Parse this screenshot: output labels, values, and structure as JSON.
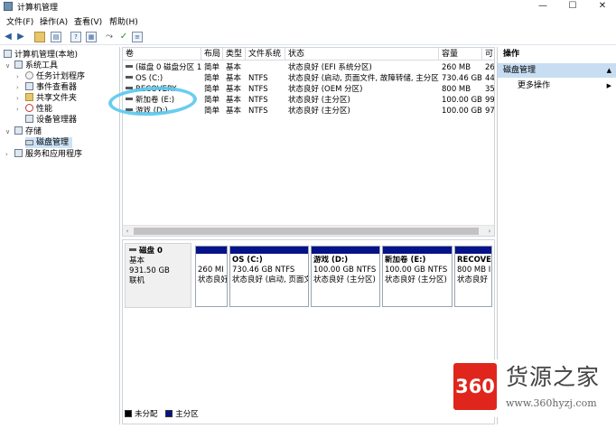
{
  "window": {
    "title": "计算机管理",
    "controls": {
      "minimize": "—",
      "maximize": "☐",
      "close": "✕"
    }
  },
  "menu": [
    "文件(F)",
    "操作(A)",
    "查看(V)",
    "帮助(H)"
  ],
  "toolbar_icons": [
    "back-arrow-icon",
    "forward-arrow-icon",
    "up-folder-icon",
    "show-hide-tree-icon",
    "help-icon",
    "properties-icon",
    "connect-icon",
    "checkmark-icon",
    "list-view-icon"
  ],
  "tree": {
    "root": "计算机管理(本地)",
    "system_tools": "系统工具",
    "task_scheduler": "任务计划程序",
    "event_viewer": "事件查看器",
    "shared_folders": "共享文件夹",
    "performance": "性能",
    "device_manager": "设备管理器",
    "storage": "存储",
    "disk_management": "磁盘管理",
    "services": "服务和应用程序"
  },
  "volume_table": {
    "headers": [
      "卷",
      "布局",
      "类型",
      "文件系统",
      "状态",
      "容量",
      "可"
    ],
    "rows": [
      {
        "name": "(磁盘 0 磁盘分区 1)",
        "layout": "简单",
        "type": "基本",
        "fs": "",
        "status": "状态良好 (EFI 系统分区)",
        "capacity": "260 MB",
        "free": "26"
      },
      {
        "name": "OS (C:)",
        "layout": "简单",
        "type": "基本",
        "fs": "NTFS",
        "status": "状态良好 (启动, 页面文件, 故障转储, 主分区)",
        "capacity": "730.46 GB",
        "free": "44"
      },
      {
        "name": "RECOVERY",
        "layout": "简单",
        "type": "基本",
        "fs": "NTFS",
        "status": "状态良好 (OEM 分区)",
        "capacity": "800 MB",
        "free": "35"
      },
      {
        "name": "新加卷 (E:)",
        "layout": "简单",
        "type": "基本",
        "fs": "NTFS",
        "status": "状态良好 (主分区)",
        "capacity": "100.00 GB",
        "free": "99"
      },
      {
        "name": "游戏 (D:)",
        "layout": "简单",
        "type": "基本",
        "fs": "NTFS",
        "status": "状态良好 (主分区)",
        "capacity": "100.00 GB",
        "free": "97"
      }
    ]
  },
  "disk0": {
    "name": "磁盘 0",
    "type": "基本",
    "size": "931.50 GB",
    "state": "联机",
    "partitions": [
      {
        "name": "",
        "size": "260 MI",
        "status": "状态良好"
      },
      {
        "name": "OS (C:)",
        "size": "730.46 GB NTFS",
        "status": "状态良好 (启动, 页面文"
      },
      {
        "name": "游戏 (D:)",
        "size": "100.00 GB NTFS",
        "status": "状态良好 (主分区)"
      },
      {
        "name": "新加卷 (E:)",
        "size": "100.00 GB NTFS",
        "status": "状态良好 (主分区)"
      },
      {
        "name": "RECOVEI",
        "size": "800 MB I",
        "status": "状态良好"
      }
    ]
  },
  "legend": {
    "unallocated": "未分配",
    "primary": "主分区",
    "unallocated_color": "#000000",
    "primary_color": "#06128a"
  },
  "actions": {
    "title": "操作",
    "section": "磁盘管理",
    "more": "更多操作"
  },
  "watermark": {
    "logo": "360",
    "text": "货源之家",
    "url": "www.360hyzj.com"
  },
  "colors": {
    "selection": "#cce3f7",
    "action_header": "#c7ddf2",
    "annotation_circle": "#5ac8ee",
    "logo_red": "#e0261c"
  }
}
